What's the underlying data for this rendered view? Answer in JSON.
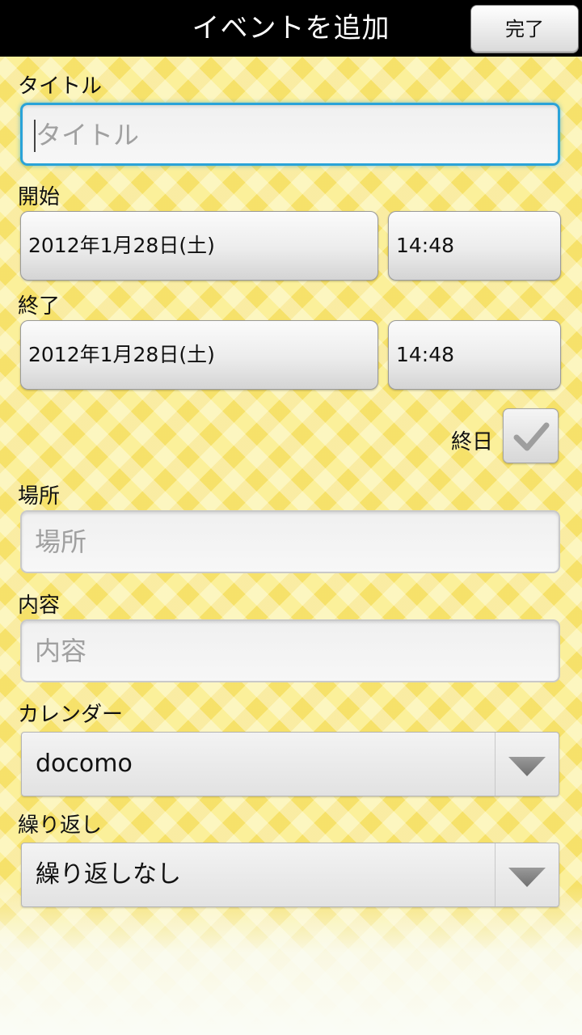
{
  "header": {
    "title": "イベントを追加",
    "done_label": "完了"
  },
  "form": {
    "title": {
      "label": "タイトル",
      "value": "",
      "placeholder": "タイトル"
    },
    "start": {
      "label": "開始",
      "date": "2012年1月28日(土)",
      "time": "14:48"
    },
    "end": {
      "label": "終了",
      "date": "2012年1月28日(土)",
      "time": "14:48"
    },
    "all_day": {
      "label": "終日",
      "checked": true
    },
    "location": {
      "label": "場所",
      "value": "",
      "placeholder": "場所"
    },
    "description": {
      "label": "内容",
      "value": "",
      "placeholder": "内容"
    },
    "calendar": {
      "label": "カレンダー",
      "selected": "docomo"
    },
    "repeat": {
      "label": "繰り返し",
      "selected": "繰り返しなし"
    }
  },
  "colors": {
    "focus_border": "#2aa3d8",
    "header_bg": "#000000",
    "background_yellow": "#fbf09a",
    "checkmark": "#9e9e9e",
    "dropdown_arrow": "#808080"
  },
  "icons": {
    "checkmark": "check-icon",
    "dropdown": "triangle-down-icon"
  }
}
